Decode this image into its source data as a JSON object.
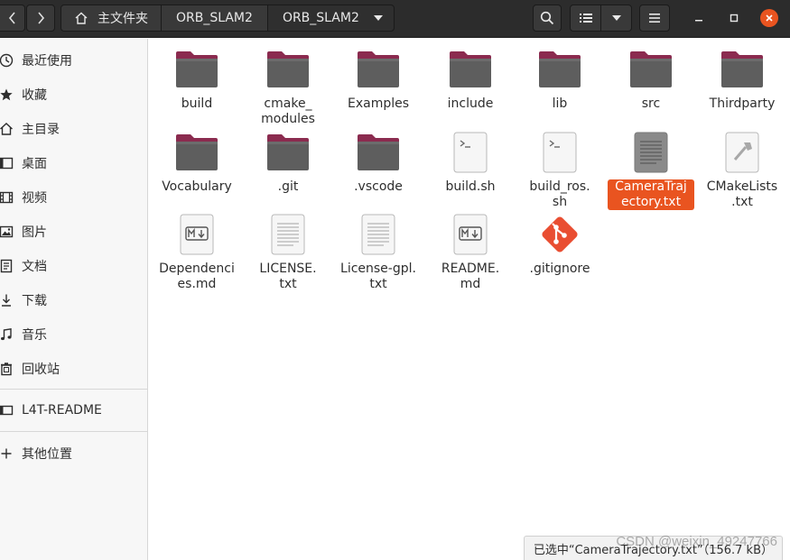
{
  "header": {
    "breadcrumbs": [
      {
        "label": "主文件夹"
      },
      {
        "label": "ORB_SLAM2"
      },
      {
        "label": "ORB_SLAM2"
      }
    ]
  },
  "sidebar": {
    "items": [
      {
        "label": "最近使用",
        "icon": "clock-icon"
      },
      {
        "label": "收藏",
        "icon": "star-icon"
      },
      {
        "label": "主目录",
        "icon": "home-icon"
      },
      {
        "label": "桌面",
        "icon": "desktop-icon"
      },
      {
        "label": "视频",
        "icon": "video-icon"
      },
      {
        "label": "图片",
        "icon": "picture-icon"
      },
      {
        "label": "文档",
        "icon": "document-icon"
      },
      {
        "label": "下载",
        "icon": "download-icon"
      },
      {
        "label": "音乐",
        "icon": "music-icon"
      },
      {
        "label": "回收站",
        "icon": "trash-icon"
      },
      {
        "label": "L4T-README",
        "icon": "drive-icon"
      },
      {
        "label": "其他位置",
        "icon": "plus-icon"
      }
    ]
  },
  "files": [
    {
      "name": "build",
      "type": "folder"
    },
    {
      "name": "cmake_\nmodules",
      "type": "folder"
    },
    {
      "name": "Examples",
      "type": "folder"
    },
    {
      "name": "include",
      "type": "folder"
    },
    {
      "name": "lib",
      "type": "folder"
    },
    {
      "name": "src",
      "type": "folder"
    },
    {
      "name": "Thirdparty",
      "type": "folder"
    },
    {
      "name": "Vocabulary",
      "type": "folder"
    },
    {
      "name": ".git",
      "type": "folder"
    },
    {
      "name": ".vscode",
      "type": "folder"
    },
    {
      "name": "build.sh",
      "type": "script"
    },
    {
      "name": "build_ros.\nsh",
      "type": "script"
    },
    {
      "name": "CameraTraj\nectory.txt",
      "type": "text",
      "selected": true
    },
    {
      "name": "CMakeLists\n.txt",
      "type": "cmake"
    },
    {
      "name": "Dependenci\nes.md",
      "type": "markdown"
    },
    {
      "name": "LICENSE.\ntxt",
      "type": "text"
    },
    {
      "name": "License-gpl.\ntxt",
      "type": "text"
    },
    {
      "name": "README.\nmd",
      "type": "markdown"
    },
    {
      "name": ".gitignore",
      "type": "git"
    }
  ],
  "status": {
    "text": "已选中“CameraTrajectory.txt”（156.7 kB）"
  },
  "watermark": "CSDN @weixin_49247766",
  "colors": {
    "accent": "#e95420",
    "header": "#2c2c2c",
    "folder_tab": "#8b2b4f",
    "folder_body": "#5e5e5e"
  }
}
